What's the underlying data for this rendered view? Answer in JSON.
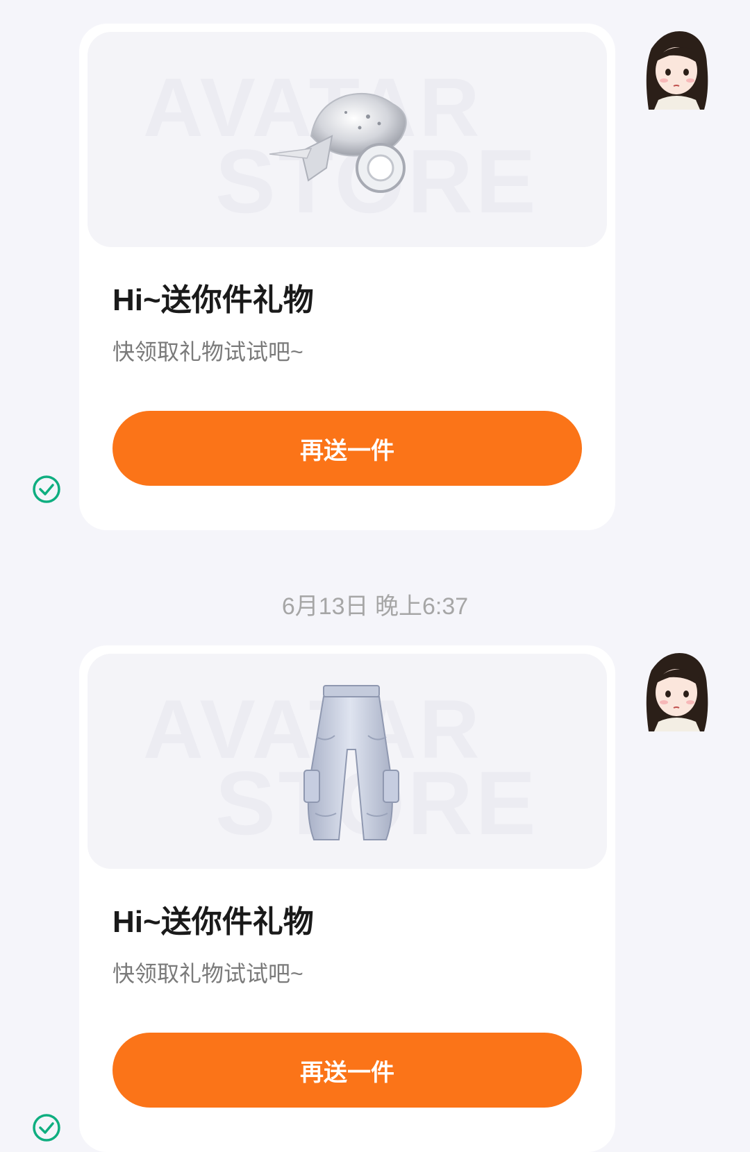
{
  "messages": [
    {
      "item_icon": "motorcycle-icon",
      "watermark_line1": "AVATAR",
      "watermark_line2": "STORE",
      "title": "Hi~送你件礼物",
      "subtitle": "快领取礼物试试吧~",
      "button_label": "再送一件",
      "status_icon": "check-circle-icon"
    },
    {
      "item_icon": "cargo-pants-icon",
      "watermark_line1": "AVATAR",
      "watermark_line2": "STORE",
      "title": "Hi~送你件礼物",
      "subtitle": "快领取礼物试试吧~",
      "button_label": "再送一件",
      "status_icon": "check-circle-icon"
    }
  ],
  "timestamp": "6月13日 晚上6:37",
  "colors": {
    "accent": "#fb7418",
    "status_green": "#0fae80",
    "background": "#f5f5fa"
  }
}
